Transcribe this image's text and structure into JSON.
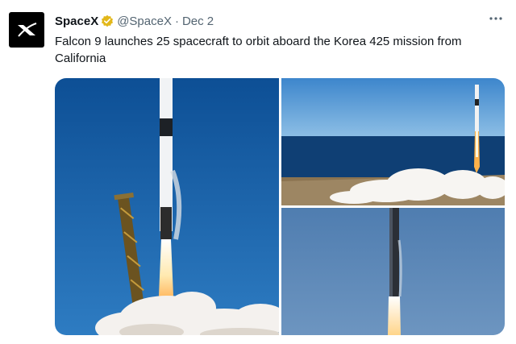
{
  "account": {
    "name": "SpaceX",
    "handle": "@SpaceX",
    "separator": "·",
    "date": "Dec 2",
    "avatar_icon": "spacex-x-logo-icon",
    "verified_icon": "gold-verified-badge-icon",
    "verified_color": "#e2b719"
  },
  "tweet": {
    "text": "Falcon 9 launches 25 spacecraft to orbit aboard the Korea 425 mission from California"
  },
  "menu": {
    "more_icon": "more-options-icon"
  },
  "media": {
    "photos": [
      {
        "subject": "rocket-launch-tower-photo"
      },
      {
        "subject": "rocket-launch-coast-photo"
      },
      {
        "subject": "rocket-ascent-closeup-photo"
      }
    ]
  },
  "colors": {
    "text_primary": "#0f1419",
    "text_secondary": "#536471",
    "sky_blue": "#1f63a8"
  }
}
